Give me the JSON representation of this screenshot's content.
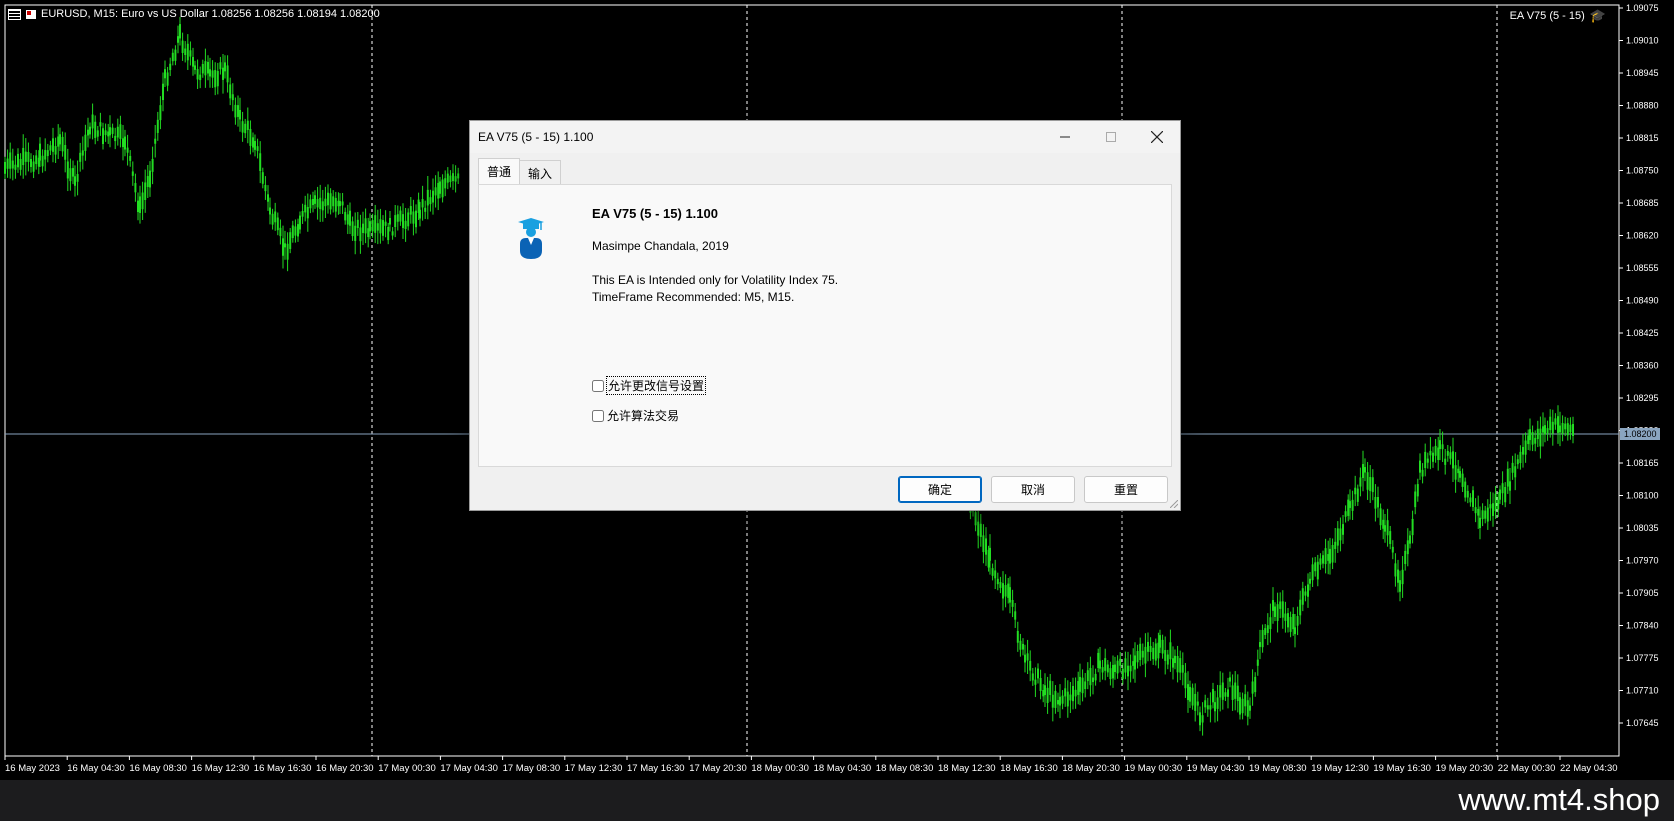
{
  "chart": {
    "title": "EURUSD, M15:  Euro vs US Dollar  1.08256 1.08256 1.08194 1.08200",
    "ea_label": "EA V75 (5 - 15)",
    "current_price": "1.08200",
    "price_levels": [
      "1.09075",
      "1.09010",
      "1.08945",
      "1.08880",
      "1.08815",
      "1.08750",
      "1.08685",
      "1.08620",
      "1.08555",
      "1.08490",
      "1.08425",
      "1.08360",
      "1.08295",
      "1.08230",
      "1.08165",
      "1.08100",
      "1.08035",
      "1.07970",
      "1.07905",
      "1.07840",
      "1.07775",
      "1.07710",
      "1.07645"
    ],
    "time_labels": [
      "16 May 2023",
      "16 May 04:30",
      "16 May 08:30",
      "16 May 12:30",
      "16 May 16:30",
      "16 May 20:30",
      "17 May 00:30",
      "17 May 04:30",
      "17 May 08:30",
      "17 May 12:30",
      "17 May 16:30",
      "17 May 20:30",
      "18 May 00:30",
      "18 May 04:30",
      "18 May 08:30",
      "18 May 12:30",
      "18 May 16:30",
      "18 May 20:30",
      "19 May 00:30",
      "19 May 04:30",
      "19 May 08:30",
      "19 May 12:30",
      "19 May 16:30",
      "19 May 20:30",
      "22 May 00:30",
      "22 May 04:30"
    ],
    "candle_color": "#22dd22"
  },
  "dialog": {
    "title": "EA V75 (5 - 15) 1.100",
    "tabs": [
      "普通",
      "输入"
    ],
    "ea_name": "EA V75 (5 - 15) 1.100",
    "author": "Masimpe Chandala, 2019",
    "description_line1": "This EA is Intended only for Volatility Index 75.",
    "description_line2": "TimeFrame Recommended: M5, M15.",
    "checkbox1": "允许更改信号设置",
    "checkbox2": "允许算法交易",
    "btn_ok": "确定",
    "btn_cancel": "取消",
    "btn_reset": "重置"
  },
  "footer": {
    "watermark": "www.mt4.shop"
  }
}
